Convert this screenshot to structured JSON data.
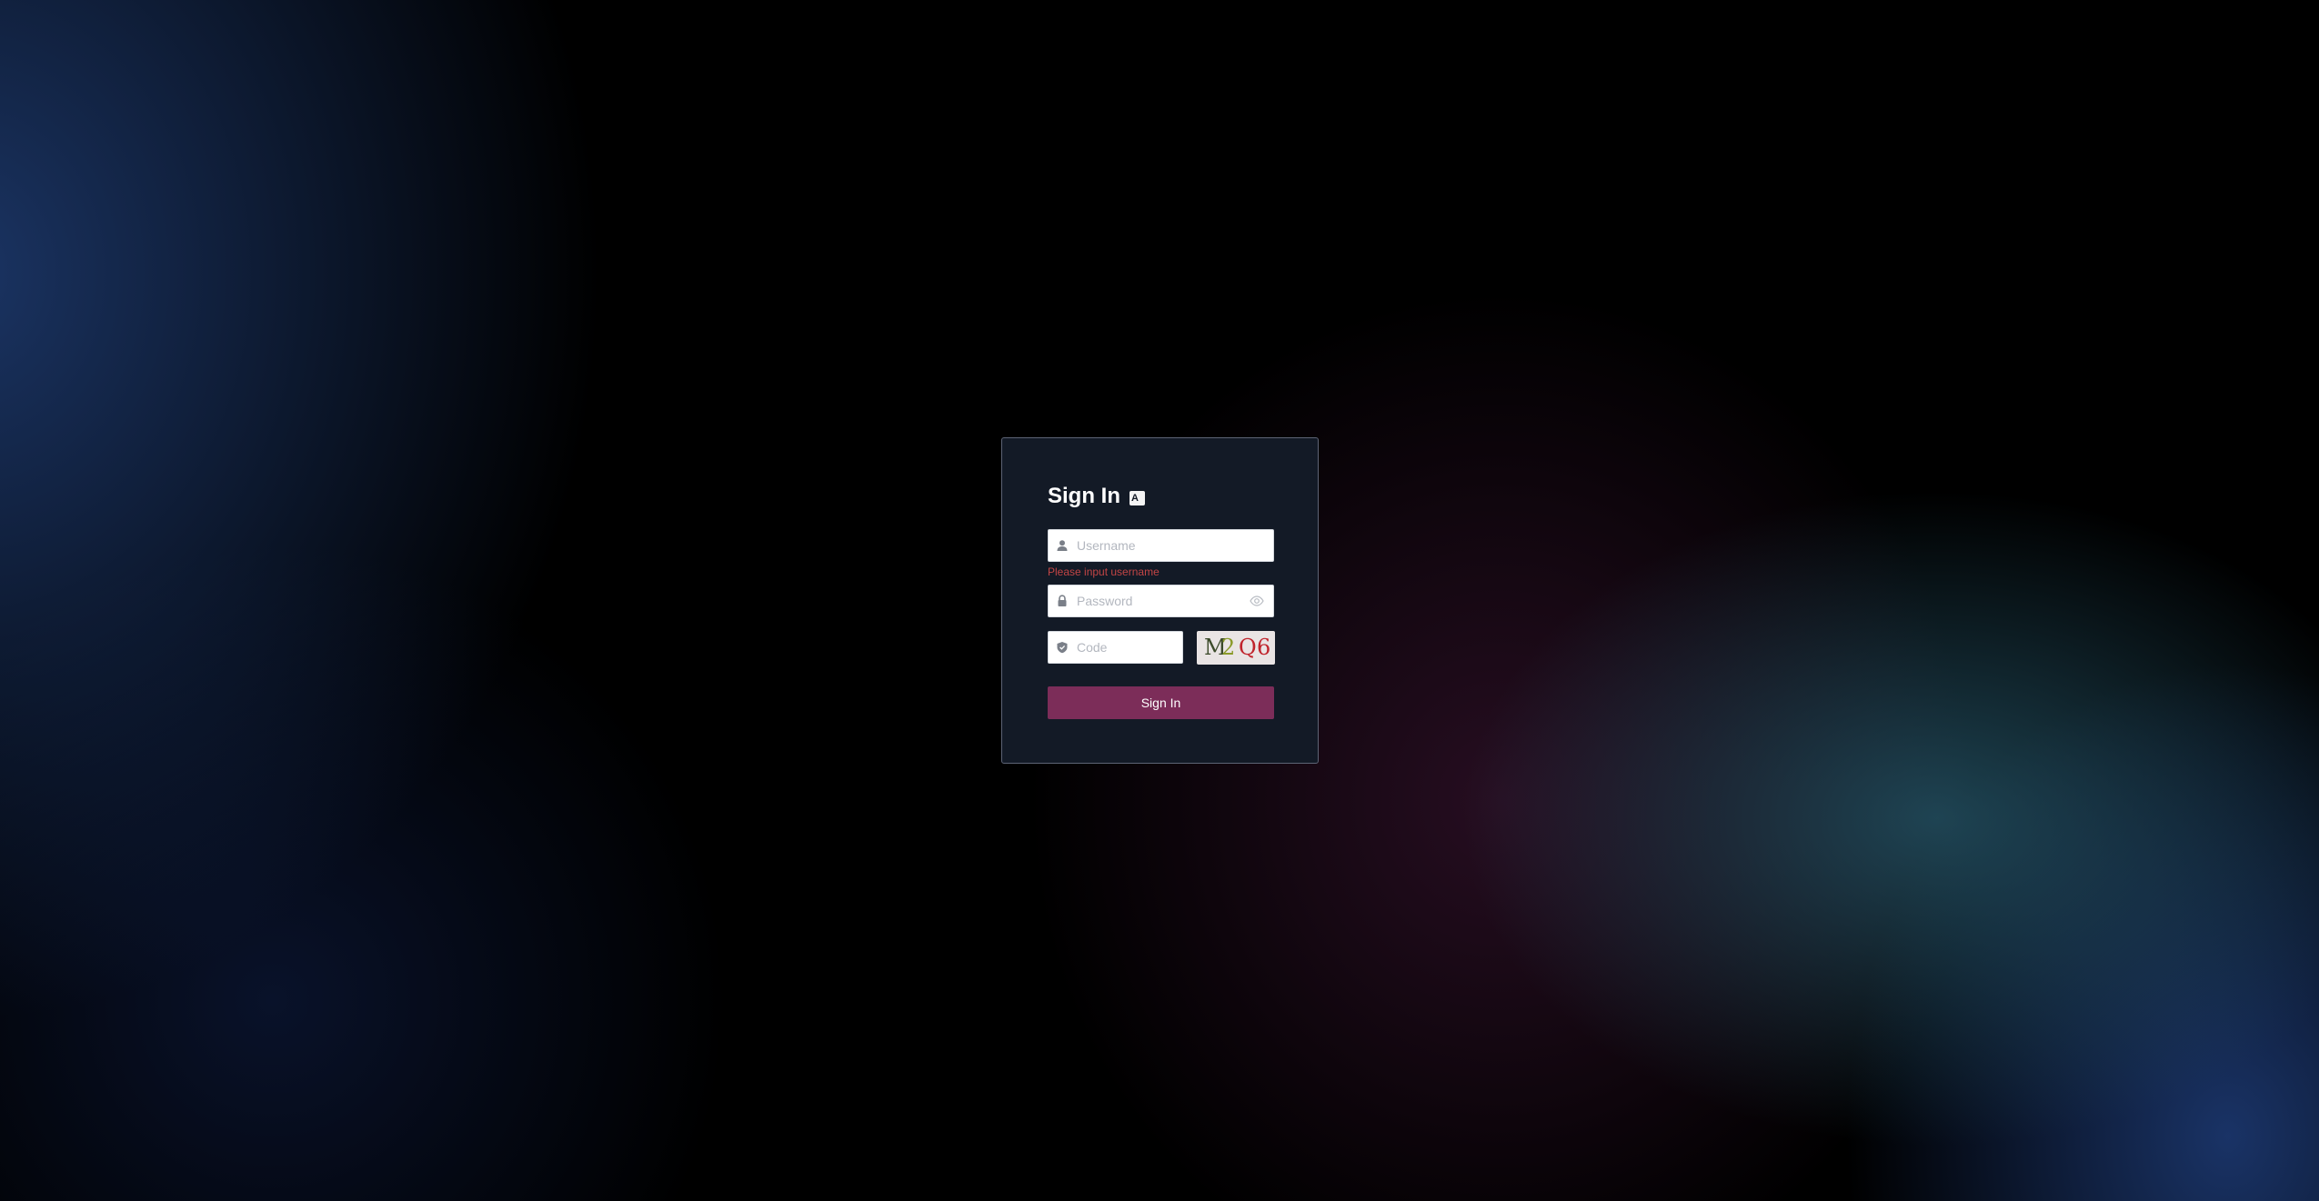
{
  "login": {
    "title": "Sign In",
    "language_icon": "translate-icon",
    "language_icon_text": "A",
    "username": {
      "placeholder": "Username",
      "value": "",
      "icon": "user-icon",
      "error": "Please input username"
    },
    "password": {
      "placeholder": "Password",
      "value": "",
      "icon": "lock-icon",
      "toggle_icon": "eye-icon"
    },
    "code": {
      "placeholder": "Code",
      "value": "",
      "icon": "shield-icon"
    },
    "captcha": {
      "chars": [
        "M",
        "2",
        "Q",
        "6"
      ]
    },
    "submit_label": "Sign In"
  },
  "colors": {
    "card_background": "#131a26",
    "card_border": "#5d6475",
    "accent": "#7c2d59",
    "error": "#c24545",
    "captcha_background": "#e9e4e4"
  }
}
